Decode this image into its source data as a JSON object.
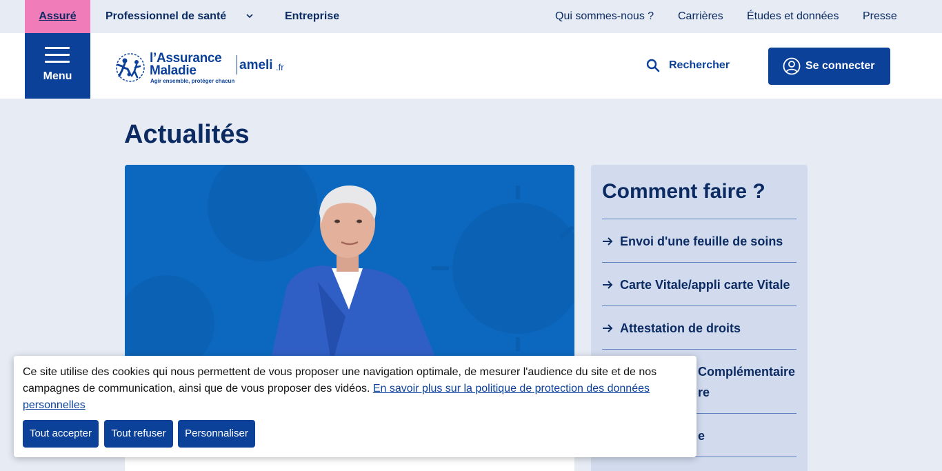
{
  "topbar": {
    "audiences": [
      "Assuré",
      "Professionnel de santé",
      "Entreprise"
    ],
    "utility_links": [
      "Qui sommes-nous ?",
      "Carrières",
      "Études et données",
      "Presse"
    ]
  },
  "header": {
    "menu_label": "Menu",
    "logo_line1": "l’Assurance",
    "logo_line2": "Maladie",
    "logo_tagline": "Agir ensemble, protéger chacun",
    "logo_site": "ameli",
    "logo_tld": ".fr",
    "search_label": "Rechercher",
    "connect_label": "Se connecter"
  },
  "main": {
    "title": "Actualités"
  },
  "howto": {
    "title": "Comment faire ?",
    "items": [
      "Envoi d'une feuille de soins",
      "Carte Vitale/appli carte Vitale",
      "Attestation de droits",
      "Complémentaire",
      "re",
      "e"
    ]
  },
  "cookie": {
    "message": "Ce site utilise des cookies qui nous permettent de vous proposer une navigation optimale, de mesurer l'audience du site et de nos campagnes de communication, ainsi que de vous proposer des vidéos. ",
    "link": "En savoir plus sur la politique de protection des données personnelles",
    "accept": "Tout accepter",
    "refuse": "Tout refuser",
    "customize": "Personnaliser"
  },
  "colors": {
    "brand_blue": "#0c419a",
    "navy_text": "#0c2b62",
    "pink_tab": "#f07cb9",
    "page_bg": "#e6ebf4",
    "panel_bg": "#d1dbed"
  }
}
